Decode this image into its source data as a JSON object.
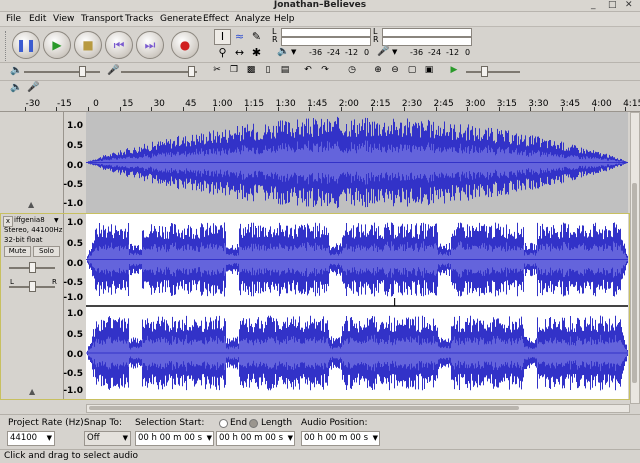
{
  "window": {
    "title": "Jonathan–Believes",
    "minimize": "_",
    "maximize": "□",
    "close": "✕"
  },
  "menu": [
    "File",
    "Edit",
    "View",
    "Transport",
    "Tracks",
    "Generate",
    "Effect",
    "Analyze",
    "Help"
  ],
  "transport": {
    "pause_icon": "pause-icon",
    "play_icon": "play-icon",
    "stop_icon": "stop-icon",
    "skip_start_icon": "skip-to-start-icon",
    "skip_end_icon": "skip-to-end-icon",
    "record_icon": "record-icon"
  },
  "meters": {
    "playback": {
      "channel_l": "L",
      "channel_r": "R",
      "scale": [
        "-36",
        "-24",
        "-12",
        "0"
      ]
    },
    "record": {
      "channel_l": "L",
      "channel_r": "R",
      "scale": [
        "-36",
        "-24",
        "-12",
        "0"
      ]
    }
  },
  "timeline": {
    "ticks": [
      "-30",
      "-15",
      "0",
      "15",
      "30",
      "45",
      "1:00",
      "1:15",
      "1:30",
      "1:45",
      "2:00",
      "2:15",
      "2:30",
      "2:45",
      "3:00",
      "3:15",
      "3:30",
      "3:45",
      "4:00",
      "4:15"
    ]
  },
  "track1": {
    "scale": [
      "1.0",
      "0.5",
      "0.0",
      "-0.5",
      "-1.0"
    ]
  },
  "track2": {
    "name": "iffgenia8",
    "close": "x",
    "menu_arrow": "▼",
    "info1": "Stereo, 44100Hz",
    "info2": "32-bit float",
    "mute": "Mute",
    "solo": "Solo",
    "pan_l": "L",
    "pan_r": "R",
    "scale_top": [
      "1.0",
      "0.5",
      "0.0",
      "-0.5",
      "-1.0"
    ],
    "scale_bottom": [
      "1.0",
      "0.5",
      "0.0",
      "-0.5",
      "-1.0"
    ]
  },
  "selection_bar": {
    "project_rate_label": "Project Rate (Hz):",
    "project_rate_value": "44100",
    "snap_label": "Snap To:",
    "snap_value": "Off",
    "selection_start_label": "Selection Start:",
    "end_label": "End",
    "length_label": "Length",
    "audio_position_label": "Audio Position:",
    "sel_start_value": "00 h 00 m 00 s",
    "sel_end_value": "00 h 00 m 00 s",
    "audio_pos_value": "00 h 00 m 00 s"
  },
  "status": "Click and drag to select audio",
  "colors": {
    "wave": "#3232c8",
    "wave_rms": "#6464dc",
    "track_bg_selected": "#ffffff",
    "track_bg": "#c0c0c0",
    "select_border": "#d0d06a"
  }
}
